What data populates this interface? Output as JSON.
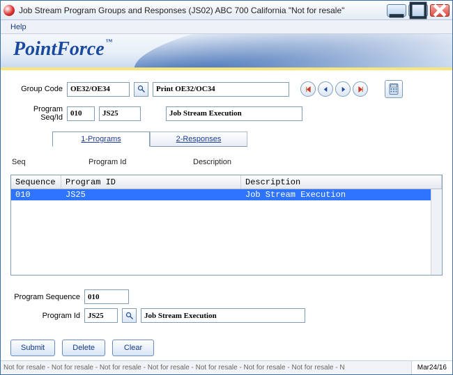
{
  "window": {
    "title": "Job Stream Program Groups and Responses (JS02)    ABC 700     California \"Not for resale\"",
    "brand": "PointForce",
    "tm": "™"
  },
  "menu": {
    "help": "Help"
  },
  "labels": {
    "group_code": "Group Code",
    "program_seq_id": "Program Seq/Id",
    "program_sequence": "Program Sequence",
    "program_id": "Program Id"
  },
  "fields": {
    "group_code": "OE32/OE34",
    "group_code_desc": "Print OE32/OC34",
    "seq": "010",
    "prog_id": "JS25",
    "prog_desc": "Job Stream Execution",
    "program_sequence": "010",
    "program_id_bottom": "JS25",
    "program_id_bottom_desc": "Job Stream Execution"
  },
  "tabs": {
    "programs": "1-Programs",
    "responses": "2-Responses"
  },
  "grid": {
    "label_seq": "Seq",
    "label_pid": "Program Id",
    "label_desc": "Description",
    "col_seq": "Sequence",
    "col_pid": "Program ID",
    "col_desc": "Description",
    "rows": [
      {
        "seq": "010",
        "pid": "JS25",
        "desc": "Job Stream Execution"
      }
    ]
  },
  "buttons": {
    "submit": "Submit",
    "delete": "Delete",
    "clear": "Clear"
  },
  "status": {
    "msg": "Not for resale - Not for resale - Not for resale - Not for resale - Not for resale - Not for resale - Not for resale - N",
    "date": "Mar24/16"
  },
  "nav_colors": {
    "first_last": "#c93a20",
    "prev_next": "#1a4aa0"
  }
}
